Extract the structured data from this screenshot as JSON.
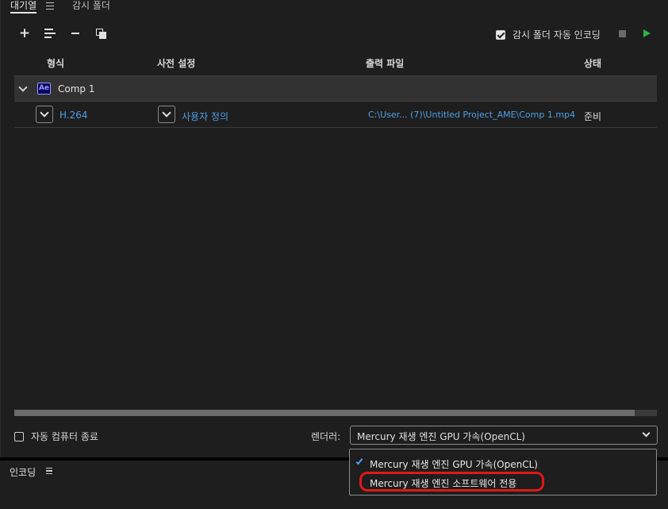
{
  "tabs": {
    "queue": "대기열",
    "watch_folder": "감시 폴더"
  },
  "toolbar": {
    "auto_encode_label": "감시 폴더 자동 인코딩",
    "auto_encode_checked": true
  },
  "columns": {
    "format": "형식",
    "preset": "사전 설정",
    "output": "출력 파일",
    "status": "상태"
  },
  "queue": {
    "group": {
      "icon": "Ae",
      "name": "Comp 1"
    },
    "item": {
      "format": "H.264",
      "preset": "사용자 정의",
      "output": "C:\\User... (7)\\Untitled Project_AME\\Comp 1.mp4",
      "status": "준비"
    }
  },
  "bottom": {
    "shutdown_label": "자동 컴퓨터 종료",
    "renderer_label": "렌더러:",
    "renderer_value": "Mercury 재생 엔진 GPU 가속(OpenCL)",
    "renderer_options": [
      "Mercury 재생 엔진 GPU 가속(OpenCL)",
      "Mercury 재생 엔진 소프트웨어 전용"
    ]
  },
  "encoding_panel": {
    "label": "인코딩"
  },
  "colors": {
    "accent_link": "#4d9fe8",
    "play": "#2fb344",
    "highlight": "#e01818",
    "background": "#1e1e1e"
  }
}
